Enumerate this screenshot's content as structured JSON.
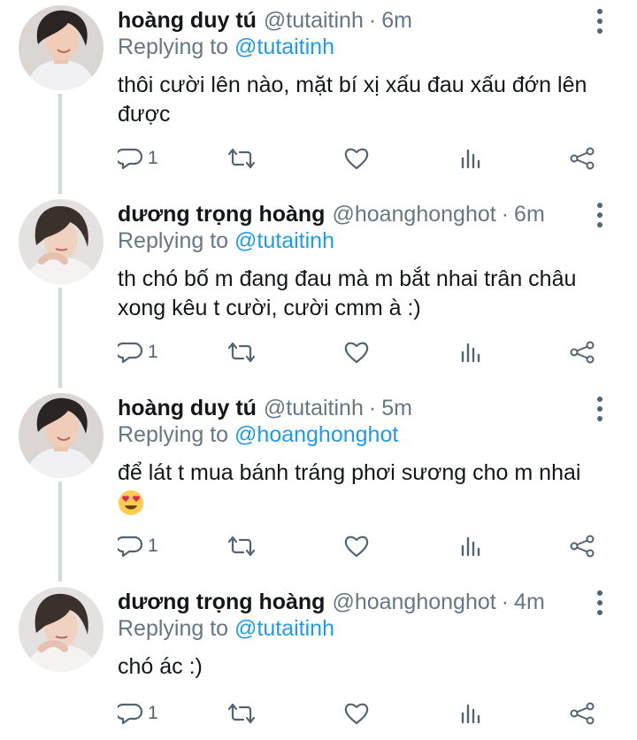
{
  "tweets": [
    {
      "name": "hoàng duy tú",
      "handle": "@tutaitinh",
      "sep": "·",
      "time": "6m",
      "replying_label": "Replying to",
      "replying_to": "@tutaitinh",
      "text": "thôi cười lên nào, mặt bí xị xấu đau xấu đớn lên được",
      "reply_count": "1",
      "avatar": "avatar-a"
    },
    {
      "name": "dương trọng hoàng",
      "handle": "@hoanghonghot",
      "sep": "·",
      "time": "6m",
      "replying_label": "Replying to",
      "replying_to": "@tutaitinh",
      "text": "th chó bố m đang đau mà m bắt nhai trân châu xong kêu t cười, cười cmm à :)",
      "reply_count": "1",
      "avatar": "avatar-b"
    },
    {
      "name": "hoàng duy tú",
      "handle": "@tutaitinh",
      "sep": "·",
      "time": "5m",
      "replying_label": "Replying to",
      "replying_to": "@hoanghonghot",
      "text": "để lát t mua bánh tráng phơi sương cho m nhai",
      "reply_count": "1",
      "avatar": "avatar-a"
    },
    {
      "name": "dương trọng hoàng",
      "handle": "@hoanghonghot",
      "sep": "·",
      "time": "4m",
      "replying_label": "Replying to",
      "replying_to": "@tutaitinh",
      "text": "chó ác :)",
      "reply_count": "1",
      "avatar": "avatar-b"
    }
  ],
  "colors": {
    "link": "#1d9bf0",
    "muted": "#657786",
    "icon": "#536471",
    "thread_line": "#cfd9de"
  },
  "icons": {
    "reply": "speech-bubble-icon",
    "retweet": "retweet-arrows-icon",
    "like": "heart-icon",
    "stats": "bar-chart-icon",
    "share": "share-nodes-icon",
    "more": "vertical-dots-icon",
    "emoji": "heart-eyes-emoji"
  }
}
